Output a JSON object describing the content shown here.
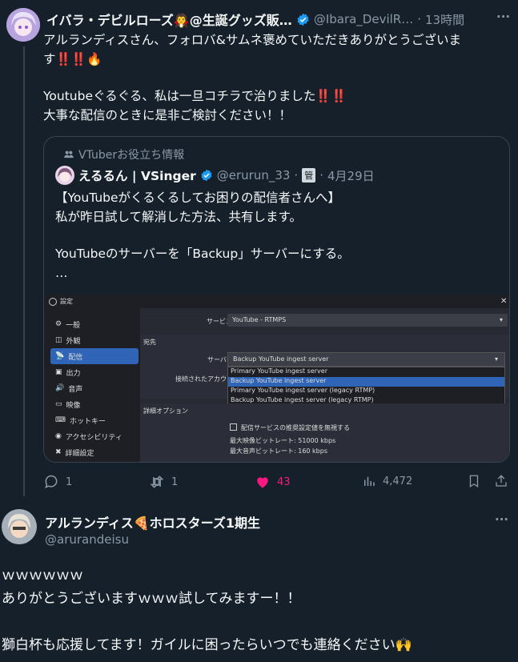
{
  "tweet": {
    "author_name": "イバラ・デビルローズ🧛@生誕グッズ販…",
    "author_handle": "@Ibara_DevilR…",
    "time_sep": "·",
    "time": "13時間",
    "more": "···",
    "lines": [
      "アルランディスさん、フォロバ&サムネ褒めていただきありがとうございま",
      "す‼️‼️🔥",
      "Youtubeぐるぐる、私は一旦コチラで治りました‼️‼️",
      "大事な配信のときに是非ご検討ください！！"
    ],
    "quote": {
      "community": "VTuberお役立ち情報",
      "author_name": "えるるん | VSinger",
      "author_handle": "@erurun_33",
      "badge": "管",
      "sep": "·",
      "date": "4月29日",
      "lines": [
        "【YouTubeがくるくるしてお困りの配信者さんへ】",
        "私が昨日試して解消した方法、共有します。",
        "YouTubeのサーバーを「Backup」サーバーにする。",
        "…"
      ],
      "screenshot": {
        "window_title": "設定",
        "close": "✕",
        "sidebar": [
          "一般",
          "外観",
          "配信",
          "出力",
          "音声",
          "映像",
          "ホットキー",
          "アクセシビリティ",
          "詳細設定"
        ],
        "service_label": "サービス",
        "service_value": "YouTube - RTMPS",
        "dest_header": "宛先",
        "server_label": "サーバー",
        "server_value": "Backup YouTube ingest server",
        "account_label": "接続されたアカウント",
        "options": [
          "Primary YouTube ingest server",
          "Backup YouTube ingest server",
          "Primary YouTube ingest server (legacy RTMP)",
          "Backup YouTube ingest server (legacy RTMP)"
        ],
        "advanced_header": "詳細オプション",
        "checkbox_label": "配信サービスの推奨設定値を無視する",
        "max_video": "最大映像ビットレート: 51000 kbps",
        "max_audio": "最大音声ビットレート: 160 kbps"
      }
    },
    "actions": {
      "reply": "1",
      "retweet": "1",
      "like": "43",
      "views": "4,472"
    }
  },
  "reply": {
    "author_name": "アルランディス🍕ホロスターズ1期生",
    "author_handle": "@arurandeisu",
    "more": "···",
    "lines": [
      "ｗｗｗｗｗｗ",
      "ありがとうございますｗｗｗ試してみますー！！",
      "獅白杯も応援してます！ガイルに困ったらいつでも連絡ください🙌"
    ]
  },
  "colors": {
    "bg": "#15202b",
    "border": "#38444d",
    "muted": "#8b98a5",
    "blue": "#1d9bf0",
    "like": "#f91880"
  }
}
